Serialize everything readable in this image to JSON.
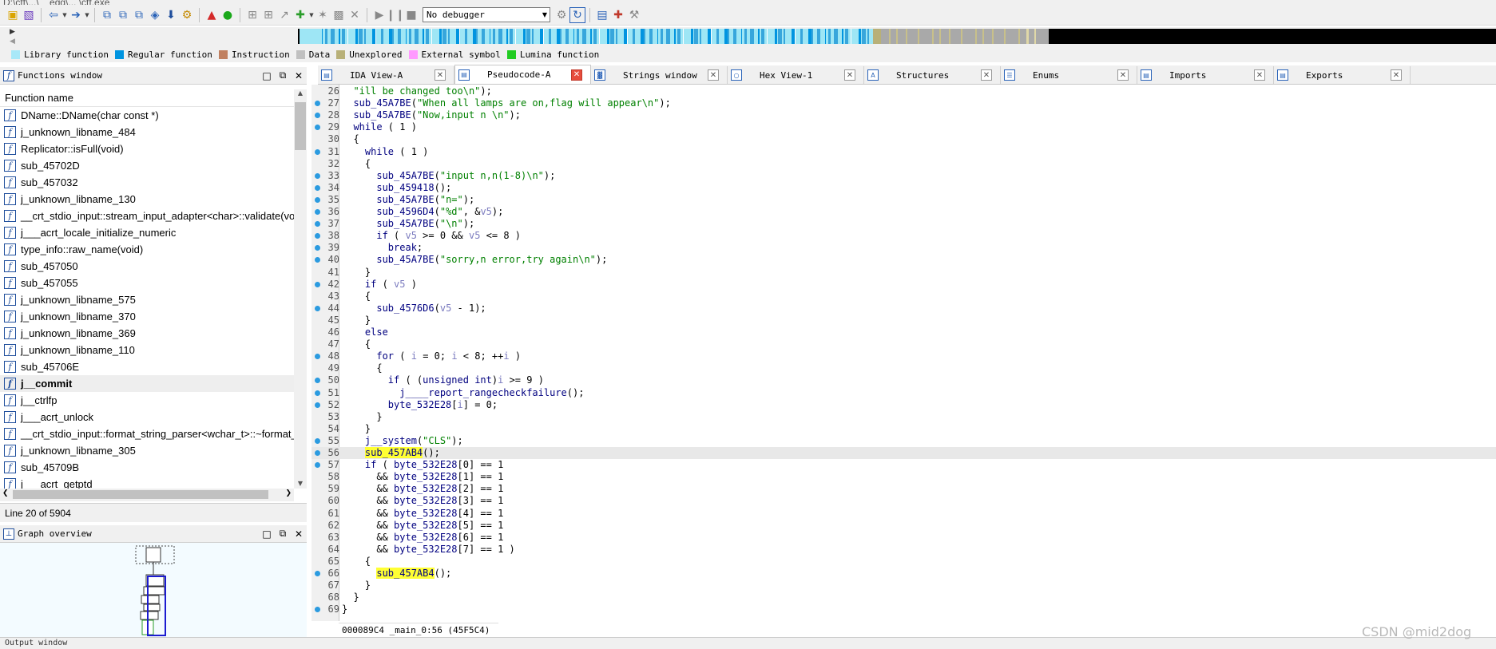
{
  "window": {
    "title_partial": "D:\\ctf\\...\\__egg\\...  \\ctf.exe"
  },
  "toolbar": {
    "debugger_select": "No debugger",
    "icons": [
      "open-icon",
      "save-icon",
      "back-icon",
      "forward-icon",
      "new-function-icon",
      "new-segment-icon",
      "search-text-icon",
      "search-binary-icon",
      "jump-down-icon",
      "search-imm-icon",
      "warning-icon",
      "run-green-icon",
      "graph-icon",
      "call-tree-icon",
      "add-struct-icon",
      "patch-icon",
      "hex-icon",
      "stop-x-icon",
      "play-icon",
      "pause-icon",
      "stop-icon",
      "debug-attach-icon",
      "debug-options-icon",
      "script-icon",
      "plugin-icon",
      "settings-icon"
    ]
  },
  "legend": [
    {
      "label": "Library function",
      "color": "#a8e8f8"
    },
    {
      "label": "Regular function",
      "color": "#0094e0"
    },
    {
      "label": "Instruction",
      "color": "#c08060"
    },
    {
      "label": "Data",
      "color": "#c0c0c0"
    },
    {
      "label": "Unexplored",
      "color": "#b8b078"
    },
    {
      "label": "External symbol",
      "color": "#ff99ff"
    },
    {
      "label": "Lumina function",
      "color": "#22cc22"
    }
  ],
  "functions_window": {
    "title": "Functions window",
    "column": "Function name",
    "items": [
      "DName::DName(char const *)",
      "j_unknown_libname_484",
      "Replicator::isFull(void)",
      "sub_45702D",
      "sub_457032",
      "j_unknown_libname_130",
      "__crt_stdio_input::stream_input_adapter<char>::validate(voi",
      "j___acrt_locale_initialize_numeric",
      "type_info::raw_name(void)",
      "sub_457050",
      "sub_457055",
      "j_unknown_libname_575",
      "j_unknown_libname_370",
      "j_unknown_libname_369",
      "j_unknown_libname_110",
      "sub_45706E",
      "j__commit",
      "j__ctrlfp",
      "j___acrt_unlock",
      "__crt_stdio_input::format_string_parser<wchar_t>::~format_",
      "j_unknown_libname_305",
      "sub_45709B",
      "j___acrt_getptd"
    ],
    "selected_index": 16,
    "status": "Line 20 of 5904"
  },
  "graph_overview": {
    "title": "Graph overview"
  },
  "tabs": [
    {
      "label": "IDA View-A",
      "active": false
    },
    {
      "label": "Pseudocode-A",
      "active": true
    },
    {
      "label": "Strings window",
      "active": false
    },
    {
      "label": "Hex View-1",
      "active": false
    },
    {
      "label": "Structures",
      "active": false
    },
    {
      "label": "Enums",
      "active": false
    },
    {
      "label": "Imports",
      "active": false
    },
    {
      "label": "Exports",
      "active": false
    }
  ],
  "code": [
    {
      "n": "26",
      "bp": false,
      "t": "  \"ill be changed too\\n\");"
    },
    {
      "n": "27",
      "bp": true,
      "t": "  sub_45A7BE(\"When all lamps are on,flag will appear\\n\");"
    },
    {
      "n": "28",
      "bp": true,
      "t": "  sub_45A7BE(\"Now,input n \\n\");"
    },
    {
      "n": "29",
      "bp": true,
      "t": "  while ( 1 )"
    },
    {
      "n": "30",
      "bp": false,
      "t": "  {"
    },
    {
      "n": "31",
      "bp": true,
      "t": "    while ( 1 )"
    },
    {
      "n": "32",
      "bp": false,
      "t": "    {"
    },
    {
      "n": "33",
      "bp": true,
      "t": "      sub_45A7BE(\"input n,n(1-8)\\n\");"
    },
    {
      "n": "34",
      "bp": true,
      "t": "      sub_459418();"
    },
    {
      "n": "35",
      "bp": true,
      "t": "      sub_45A7BE(\"n=\");"
    },
    {
      "n": "36",
      "bp": true,
      "t": "      sub_4596D4(\"%d\", &v5);"
    },
    {
      "n": "37",
      "bp": true,
      "t": "      sub_45A7BE(\"\\n\");"
    },
    {
      "n": "38",
      "bp": true,
      "t": "      if ( v5 >= 0 && v5 <= 8 )"
    },
    {
      "n": "39",
      "bp": true,
      "t": "        break;"
    },
    {
      "n": "40",
      "bp": true,
      "t": "      sub_45A7BE(\"sorry,n error,try again\\n\");"
    },
    {
      "n": "41",
      "bp": false,
      "t": "    }"
    },
    {
      "n": "42",
      "bp": true,
      "t": "    if ( v5 )"
    },
    {
      "n": "43",
      "bp": false,
      "t": "    {"
    },
    {
      "n": "44",
      "bp": true,
      "t": "      sub_4576D6(v5 - 1);"
    },
    {
      "n": "45",
      "bp": false,
      "t": "    }"
    },
    {
      "n": "46",
      "bp": false,
      "t": "    else"
    },
    {
      "n": "47",
      "bp": false,
      "t": "    {"
    },
    {
      "n": "48",
      "bp": true,
      "t": "      for ( i = 0; i < 8; ++i )"
    },
    {
      "n": "49",
      "bp": false,
      "t": "      {"
    },
    {
      "n": "50",
      "bp": true,
      "t": "        if ( (unsigned int)i >= 9 )"
    },
    {
      "n": "51",
      "bp": true,
      "t": "          j____report_rangecheckfailure();"
    },
    {
      "n": "52",
      "bp": true,
      "t": "        byte_532E28[i] = 0;"
    },
    {
      "n": "53",
      "bp": false,
      "t": "      }"
    },
    {
      "n": "54",
      "bp": false,
      "t": "    }"
    },
    {
      "n": "55",
      "bp": true,
      "t": "    j__system(\"CLS\");"
    },
    {
      "n": "56",
      "bp": true,
      "t": "    sub_457AB4();"
    },
    {
      "n": "57",
      "bp": true,
      "t": "    if ( byte_532E28[0] == 1"
    },
    {
      "n": "58",
      "bp": false,
      "t": "      && byte_532E28[1] == 1"
    },
    {
      "n": "59",
      "bp": false,
      "t": "      && byte_532E28[2] == 1"
    },
    {
      "n": "60",
      "bp": false,
      "t": "      && byte_532E28[3] == 1"
    },
    {
      "n": "61",
      "bp": false,
      "t": "      && byte_532E28[4] == 1"
    },
    {
      "n": "62",
      "bp": false,
      "t": "      && byte_532E28[5] == 1"
    },
    {
      "n": "63",
      "bp": false,
      "t": "      && byte_532E28[6] == 1"
    },
    {
      "n": "64",
      "bp": false,
      "t": "      && byte_532E28[7] == 1 )"
    },
    {
      "n": "65",
      "bp": false,
      "t": "    {"
    },
    {
      "n": "66",
      "bp": true,
      "t": "      sub_457AB4();"
    },
    {
      "n": "67",
      "bp": false,
      "t": "    }"
    },
    {
      "n": "68",
      "bp": false,
      "t": "  }"
    },
    {
      "n": "69",
      "bp": true,
      "t": "}"
    }
  ],
  "current_line": "56",
  "code_status": "000089C4 _main_0:56 (45F5C4)",
  "bottom_bar": "Output window",
  "watermark": "CSDN @mid2dog"
}
